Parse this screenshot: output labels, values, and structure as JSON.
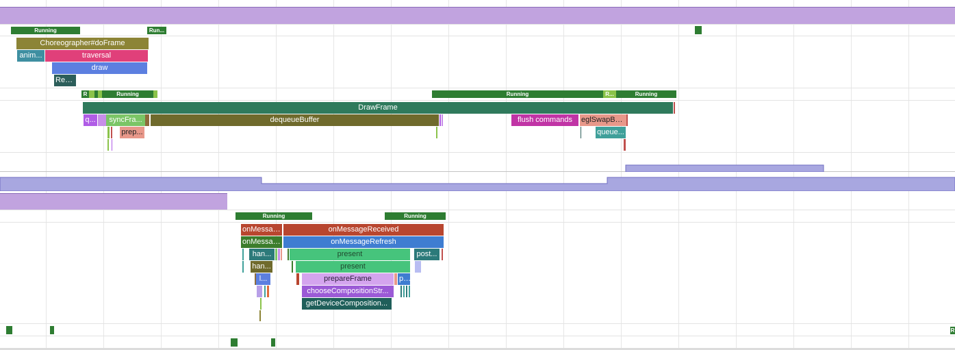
{
  "colors": {
    "running": "#2e7d32",
    "runnable": "#8bc34a",
    "process_band": "#c1a3df",
    "counter": "#a8a7e0"
  },
  "threads": {
    "main_states": [
      {
        "label": "Running"
      },
      {
        "label": "Run..."
      }
    ],
    "main_slices": [
      {
        "label": "Choreographer#doFrame"
      },
      {
        "label": "anim..."
      },
      {
        "label": "traversal"
      },
      {
        "label": "draw"
      },
      {
        "label": "Rec..."
      }
    ],
    "render_states": [
      {
        "label": "R"
      },
      {
        "label": "Running"
      },
      {
        "label": "Running"
      },
      {
        "label": "R..."
      },
      {
        "label": "Running"
      }
    ],
    "render_slices": [
      {
        "label": "DrawFrame"
      },
      {
        "label": "q..."
      },
      {
        "label": "syncFra..."
      },
      {
        "label": "dequeueBuffer"
      },
      {
        "label": "flush commands"
      },
      {
        "label": "eglSwapBu..."
      },
      {
        "label": "prep..."
      },
      {
        "label": "queue..."
      }
    ],
    "sf_states": [
      {
        "label": "Running"
      },
      {
        "label": "Running"
      }
    ],
    "sf_slices": [
      {
        "label": "onMessag..."
      },
      {
        "label": "onMessageReceived"
      },
      {
        "label": "onMessag..."
      },
      {
        "label": "onMessageRefresh"
      },
      {
        "label": "han..."
      },
      {
        "label": "present"
      },
      {
        "label": "post..."
      },
      {
        "label": "han..."
      },
      {
        "label": "present"
      },
      {
        "label": "l..."
      },
      {
        "label": "prepareFrame"
      },
      {
        "label": "p..."
      },
      {
        "label": "chooseCompositionStr..."
      },
      {
        "label": "getDeviceComposition..."
      }
    ],
    "bottom_states": [
      {
        "label": "R"
      }
    ]
  }
}
